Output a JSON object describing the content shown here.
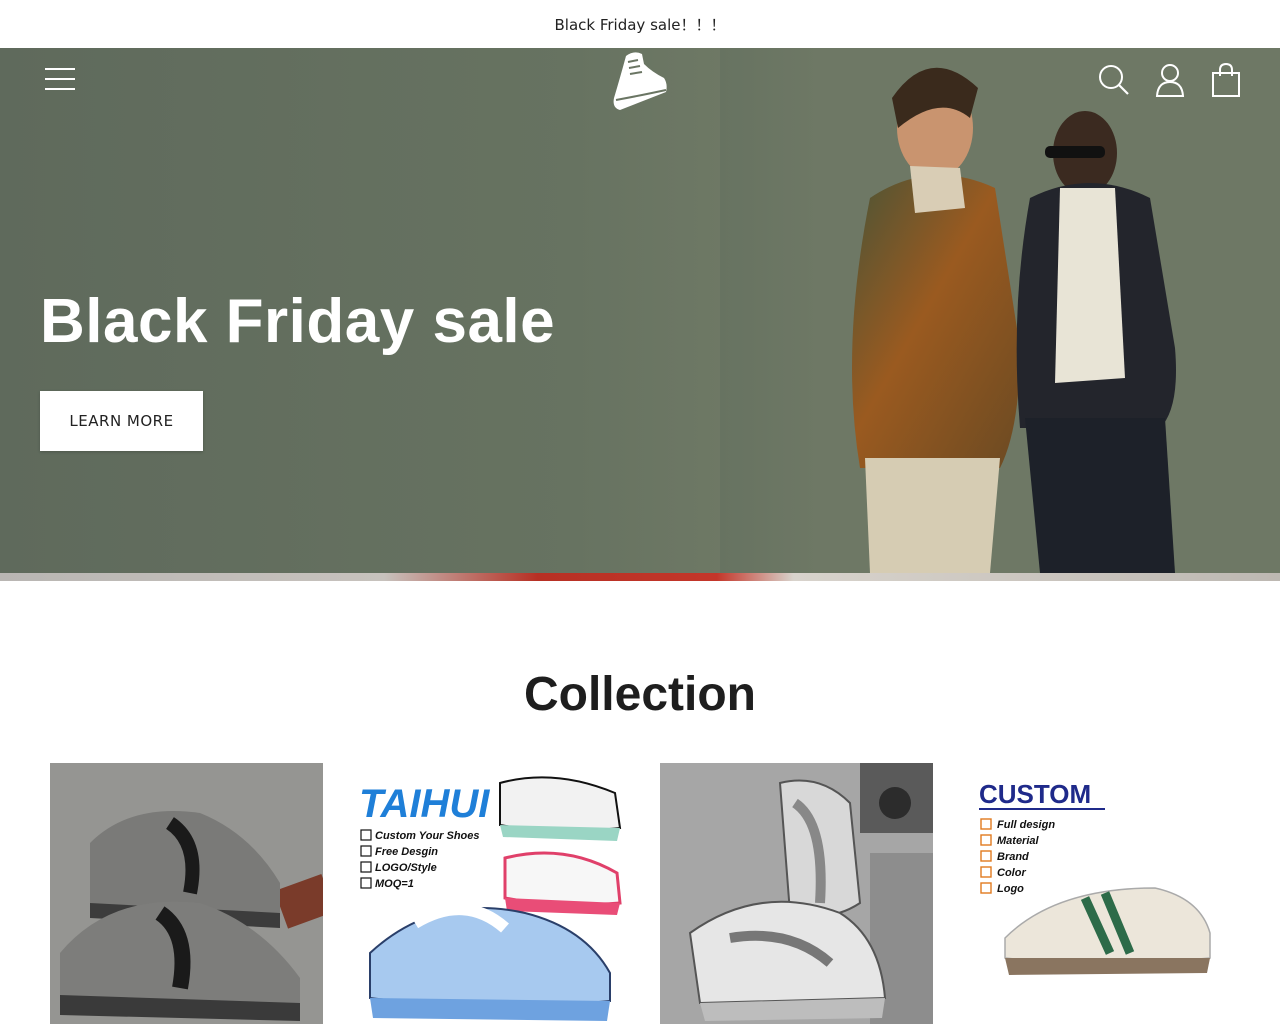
{
  "announcement": "Black Friday sale！！！",
  "header": {
    "menu_icon": "hamburger-icon",
    "logo_icon": "sneaker-logo",
    "icons": [
      "search-icon",
      "account-icon",
      "cart-bag-icon"
    ]
  },
  "hero": {
    "title": "Black Friday sale",
    "cta_label": "LEARN MORE",
    "slides_total": 2,
    "active_slide": 1
  },
  "collection": {
    "title": "Collection",
    "cards": [
      {
        "image": "grey-black-chunky-sneakers"
      },
      {
        "image": "taihui-custom-sneakers",
        "brand_text": "TAIHUI",
        "lines": [
          "Custom Your Shoes",
          "Free Desgin",
          "LOGO/Style",
          "MOQ=1"
        ]
      },
      {
        "image": "grey-white-running-sneakers"
      },
      {
        "image": "custom-retro-sneaker",
        "heading": "CUSTOM",
        "lines": [
          "Full design",
          "Material",
          "Brand",
          "Color",
          "Logo"
        ]
      }
    ]
  },
  "colors": {
    "hero_bg": "#677361",
    "text": "#222222",
    "white": "#ffffff"
  }
}
